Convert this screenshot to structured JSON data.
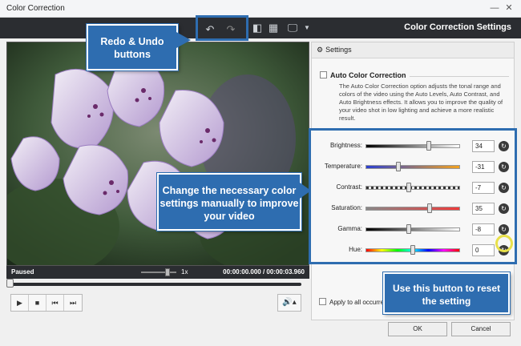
{
  "window": {
    "title": "Color Correction"
  },
  "toolbar": {
    "heading": "Color Correction Settings",
    "undo_icon": "undo-icon",
    "redo_icon": "redo-icon",
    "compare_icon": "split-view-icon",
    "grid_icon": "grid-icon",
    "display_icon": "monitor-icon"
  },
  "player": {
    "status": "Paused",
    "speed": "1x",
    "time": "00:00:00.000 / 00:00:03.960",
    "progress_fraction": 0.0,
    "speed_slider_fraction": 0.7
  },
  "settings": {
    "header": "Settings",
    "auto_label": "Auto Color Correction",
    "auto_checked": false,
    "auto_description": "The Auto Color Correction option adjusts the tonal range and colors of the video using the Auto Levels, Auto Contrast, and Auto Brightness effects. It allows you to improve the quality of your video shot in low lighting and achieve a more realistic result.",
    "sliders": [
      {
        "label": "Brightness:",
        "value": "34",
        "fraction": 0.67,
        "gradient": "linear-gradient(to right,#000,#fff)"
      },
      {
        "label": "Temperature:",
        "value": "-31",
        "fraction": 0.35,
        "gradient": "linear-gradient(to right,#2a3fd0,#f2a11e)"
      },
      {
        "label": "Contrast:",
        "value": "-7",
        "fraction": 0.46,
        "gradient": "repeating-linear-gradient(to right,#333 0 3px,#eee 3px 6px)"
      },
      {
        "label": "Saturation:",
        "value": "35",
        "fraction": 0.68,
        "gradient": "linear-gradient(to right,#888,#f03a3a)"
      },
      {
        "label": "Gamma:",
        "value": "-8",
        "fraction": 0.46,
        "gradient": "linear-gradient(to right,#000,#fff)"
      },
      {
        "label": "Hue:",
        "value": "0",
        "fraction": 0.5,
        "gradient": "linear-gradient(to right,#f00,#ff0,#0f0,#0ff,#00f,#f0f,#f00)"
      }
    ],
    "apply_all_label": "Apply to all occurrer"
  },
  "buttons": {
    "ok": "OK",
    "cancel": "Cancel"
  },
  "callouts": {
    "undo": "Redo & Undo buttons",
    "color": "Change the necessary color settings manually to improve your video",
    "reset": "Use this button to reset the setting"
  },
  "colors": {
    "accent": "#2e6db0",
    "dark_bar": "#2b2d31",
    "highlight": "#e8e04a"
  }
}
